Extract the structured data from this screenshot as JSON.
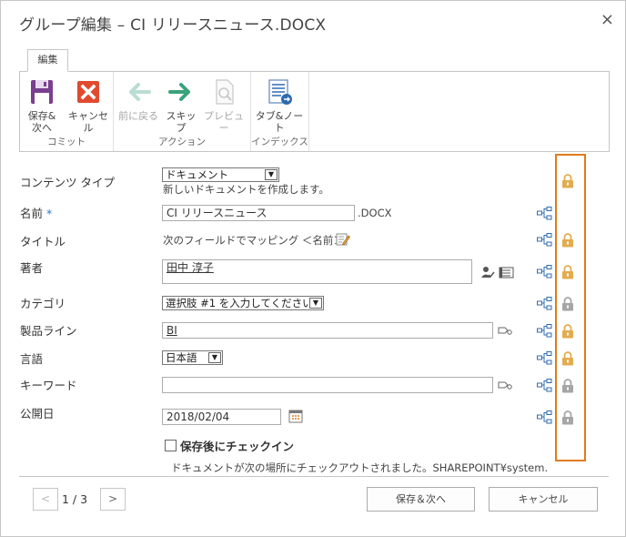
{
  "dialog": {
    "title": "グループ編集 – CI リリースニュース.DOCX",
    "close": "×"
  },
  "ribbon": {
    "tab": "編集",
    "groups": [
      {
        "label": "コミット",
        "buttons": [
          {
            "label": "保存&\n次へ"
          },
          {
            "label": "キャンセル"
          }
        ]
      },
      {
        "label": "アクション",
        "buttons": [
          {
            "label": "前に戻る"
          },
          {
            "label": "スキップ"
          },
          {
            "label": "プレビュー"
          }
        ]
      },
      {
        "label": "インデックス",
        "buttons": [
          {
            "label": "タブ&ノート"
          }
        ]
      }
    ]
  },
  "fields": {
    "content_type": {
      "label": "コンテンツ タイプ",
      "value": "ドキュメント",
      "hint": "新しいドキュメントを作成します。"
    },
    "name": {
      "label": "名前",
      "required": "*",
      "value": "CI リリースニュース",
      "suffix": ".DOCX"
    },
    "title": {
      "label": "タイトル",
      "value": "次のフィールドでマッピング  ＜名前＞"
    },
    "author": {
      "label": "著者",
      "value": "田中 淳子"
    },
    "category": {
      "label": "カテゴリ",
      "value": "選択肢 #1 を入力してください"
    },
    "product_line": {
      "label": "製品ライン",
      "value": "BI"
    },
    "language": {
      "label": "言語",
      "value": "日本語"
    },
    "keyword": {
      "label": "キーワード",
      "value": ""
    },
    "publish_date": {
      "label": "公開日",
      "value": "2018/02/04"
    }
  },
  "checkin": {
    "label": "保存後にチェックイン",
    "checked": false
  },
  "status": "ドキュメントが次の場所にチェックアウトされました。SHAREPOINT¥system.",
  "pager": {
    "prev": "<",
    "text": "1 / 3",
    "next": ">"
  },
  "footer": {
    "save_next": "保存＆次へ",
    "cancel": "キャンセル"
  },
  "colors": {
    "accent_orange": "#e07b1c",
    "lock_gold": "#e3ac4f",
    "lock_gray": "#a6a6a6",
    "link_blue": "#1e78c8"
  }
}
